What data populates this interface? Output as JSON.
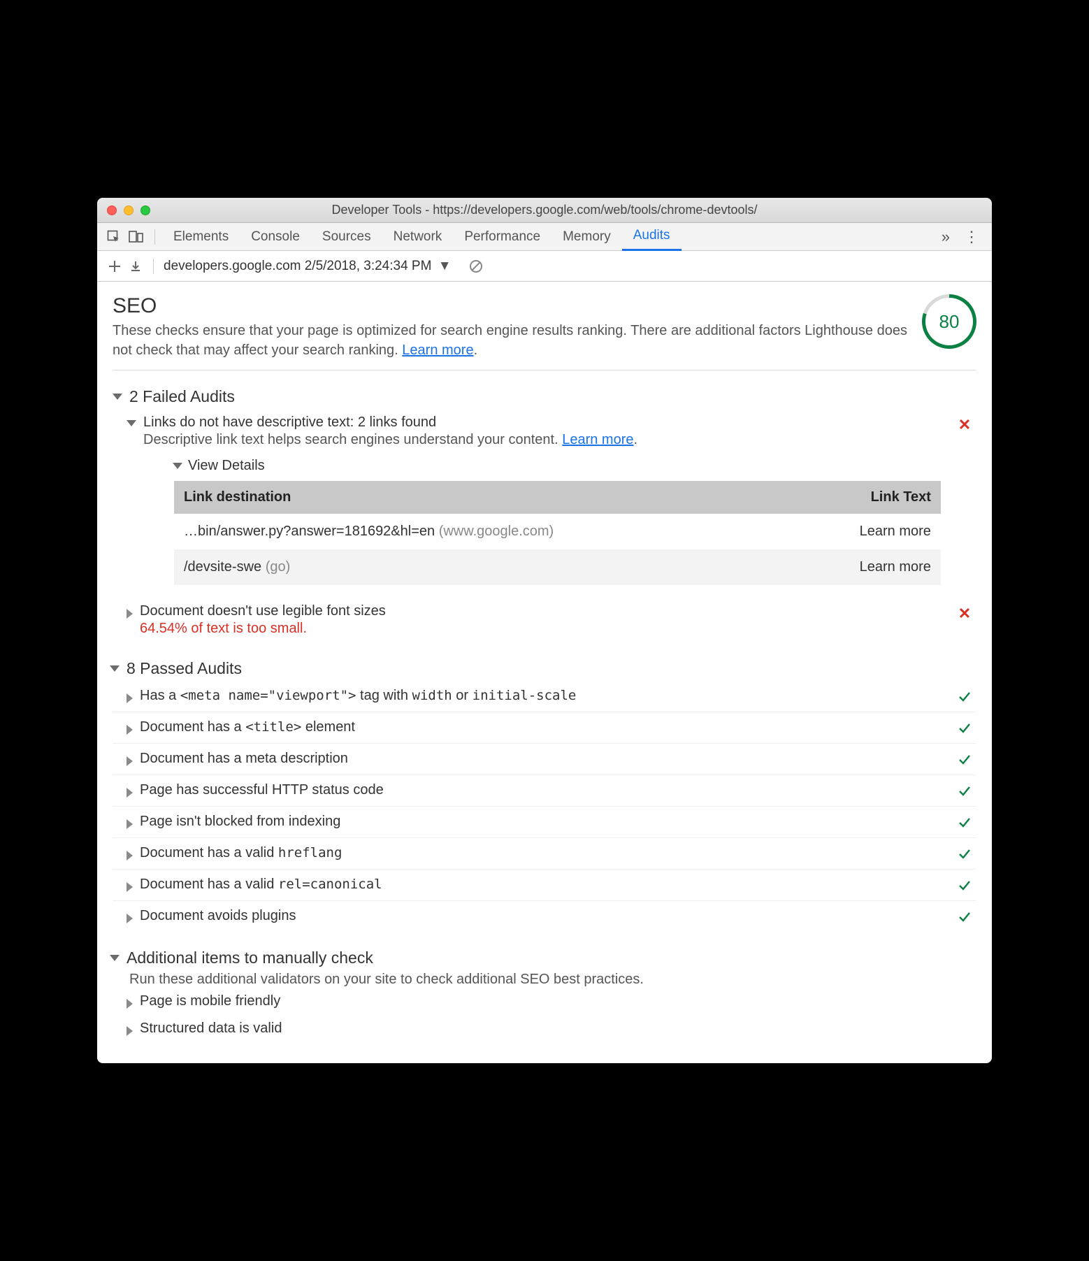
{
  "window": {
    "title": "Developer Tools - https://developers.google.com/web/tools/chrome-devtools/"
  },
  "tabs": {
    "items": [
      "Elements",
      "Console",
      "Sources",
      "Network",
      "Performance",
      "Memory",
      "Audits"
    ],
    "active": "Audits"
  },
  "secondbar": {
    "report_label": "developers.google.com 2/5/2018, 3:24:34 PM"
  },
  "seo": {
    "title": "SEO",
    "desc_1": "These checks ensure that your page is optimized for search engine results ranking. There are additional factors Lighthouse does not check that may affect your search ranking. ",
    "learn_more": "Learn more",
    "score": "80"
  },
  "failed": {
    "heading": "2 Failed Audits",
    "items": [
      {
        "title": "Links do not have descriptive text: 2 links found",
        "sub": "Descriptive link text helps search engines understand your content. ",
        "learn_more": "Learn more",
        "expanded": true,
        "view_details": "View Details",
        "table": {
          "col1": "Link destination",
          "col2": "Link Text",
          "rows": [
            {
              "dest": "…bin/answer.py?answer=181692&hl=en",
              "host": "(www.google.com)",
              "text": "Learn more"
            },
            {
              "dest": "/devsite-swe",
              "host": "(go)",
              "text": "Learn more"
            }
          ]
        }
      },
      {
        "title": "Document doesn't use legible font sizes",
        "warn": "64.54% of text is too small.",
        "expanded": false
      }
    ]
  },
  "passed": {
    "heading": "8 Passed Audits",
    "items": [
      {
        "pre": "Has a ",
        "code": "<meta name=\"viewport\">",
        "mid": " tag with ",
        "code2": "width",
        "mid2": " or ",
        "code3": "initial-scale"
      },
      {
        "pre": "Document has a ",
        "code": "<title>",
        "mid": " element"
      },
      {
        "pre": "Document has a meta description"
      },
      {
        "pre": "Page has successful HTTP status code"
      },
      {
        "pre": "Page isn't blocked from indexing"
      },
      {
        "pre": "Document has a valid ",
        "code": "hreflang"
      },
      {
        "pre": "Document has a valid ",
        "code": "rel=canonical"
      },
      {
        "pre": "Document avoids plugins"
      }
    ]
  },
  "manual": {
    "heading": "Additional items to manually check",
    "desc": "Run these additional validators on your site to check additional SEO best practices.",
    "items": [
      {
        "title": "Page is mobile friendly"
      },
      {
        "title": "Structured data is valid"
      }
    ]
  }
}
